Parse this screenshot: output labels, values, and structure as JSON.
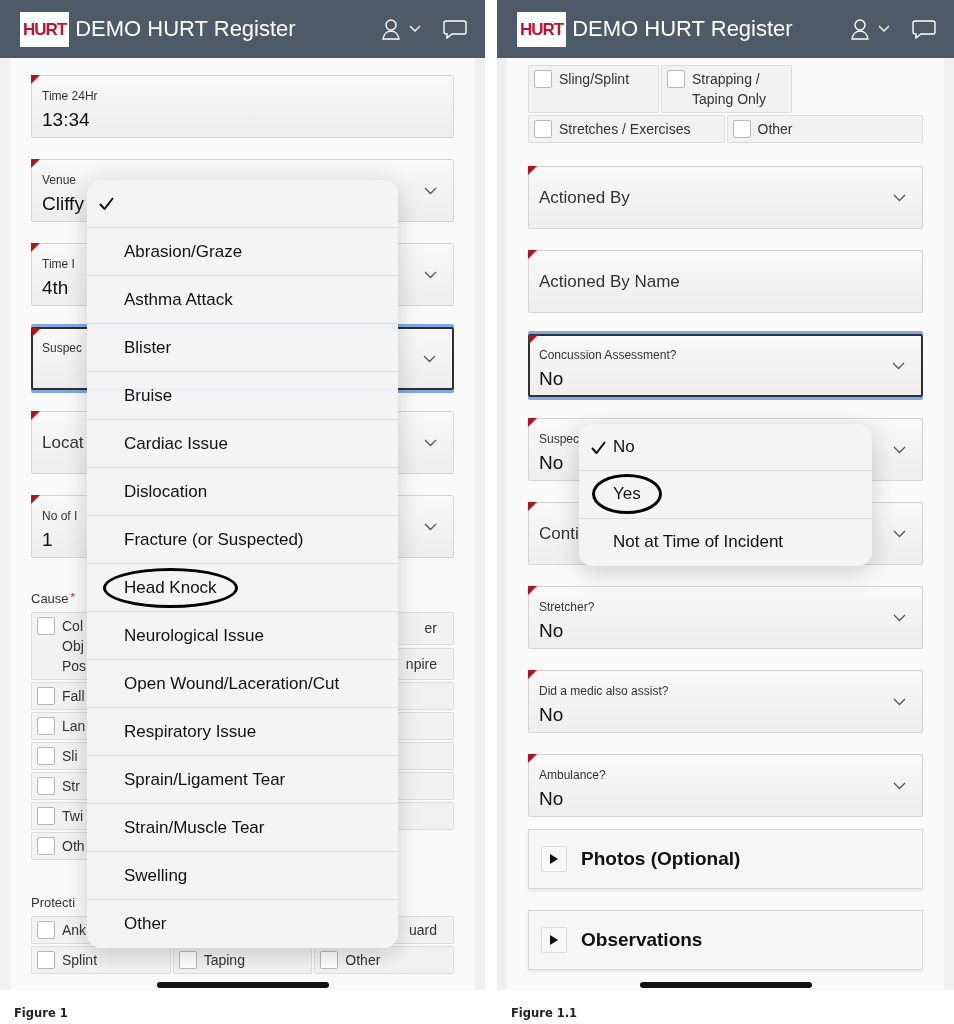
{
  "figures": [
    {
      "header": {
        "logo": "HURT",
        "title": "DEMO HURT Register"
      },
      "items": [
        {
          "kind": "field",
          "label": "Time 24Hr",
          "value": "13:34",
          "dropdown": false,
          "focused": false,
          "required": true
        },
        {
          "kind": "field",
          "label": "Venue",
          "value": "Cliffy",
          "dropdown": true,
          "focused": false,
          "required": true
        },
        {
          "kind": "field",
          "label": "Time I",
          "value": "4th",
          "dropdown": true,
          "focused": false,
          "required": true
        },
        {
          "kind": "field",
          "label": "Suspec",
          "dropdown": true,
          "focused": true,
          "required": true
        },
        {
          "kind": "field",
          "label": "Locat",
          "dropdown": true,
          "focused": false,
          "required": true
        },
        {
          "kind": "field",
          "label": "No of I",
          "value": "1",
          "dropdown": true,
          "focused": false,
          "required": true
        },
        {
          "kind": "checks",
          "label": "Cause",
          "required_mark": "*",
          "rows": [
            {
              "cells": [
                {
                  "kind": "check",
                  "lines": [
                    "Col",
                    "Obj",
                    "Pos"
                  ],
                  "checked": false
                },
                {
                  "kind": "spacer"
                },
                {
                  "kind": "stack",
                  "cells": [
                    {
                      "kind": "tail",
                      "label": "er"
                    },
                    {
                      "kind": "tail",
                      "label": "npire"
                    }
                  ]
                }
              ]
            },
            {
              "cells": [
                {
                  "kind": "check",
                  "label": "Fall",
                  "checked": false
                },
                {
                  "kind": "spacer"
                },
                {
                  "kind": "blank"
                }
              ]
            },
            {
              "cells": [
                {
                  "kind": "check",
                  "label": "Lan",
                  "checked": false
                },
                {
                  "kind": "spacer"
                },
                {
                  "kind": "blank"
                }
              ]
            },
            {
              "cells": [
                {
                  "kind": "check",
                  "label": "Sli",
                  "checked": false
                },
                {
                  "kind": "spacer"
                },
                {
                  "kind": "blank"
                }
              ]
            },
            {
              "cells": [
                {
                  "kind": "check",
                  "label": "Str",
                  "checked": false
                },
                {
                  "kind": "blank"
                },
                {
                  "kind": "blank"
                }
              ]
            },
            {
              "cells": [
                {
                  "kind": "check",
                  "label": "Twi",
                  "checked": false
                },
                {
                  "kind": "blank"
                },
                {
                  "kind": "blank"
                }
              ]
            },
            {
              "cells": [
                {
                  "kind": "check",
                  "label": "Oth",
                  "checked": false
                },
                {
                  "kind": "spacer"
                },
                {
                  "kind": "spacer"
                }
              ]
            }
          ]
        },
        {
          "kind": "checks",
          "label": "Protecti",
          "rows": [
            {
              "cells": [
                {
                  "kind": "check",
                  "label": "Ank",
                  "checked": false
                },
                {
                  "kind": "blank"
                },
                {
                  "kind": "tail",
                  "label": "uard"
                }
              ]
            },
            {
              "cells": [
                {
                  "kind": "check",
                  "label": "Splint",
                  "checked": false
                },
                {
                  "kind": "check",
                  "label": "Taping",
                  "checked": false
                },
                {
                  "kind": "check",
                  "label": "Other",
                  "checked": false
                }
              ]
            }
          ]
        }
      ],
      "menu": {
        "options": [
          {
            "selected": true,
            "circled": false
          },
          {
            "label": "Abrasion/Graze",
            "selected": false,
            "circled": false
          },
          {
            "label": "Asthma Attack",
            "selected": false,
            "circled": false
          },
          {
            "label": "Blister",
            "selected": false,
            "circled": false
          },
          {
            "label": "Bruise",
            "selected": false,
            "circled": false
          },
          {
            "label": "Cardiac Issue",
            "selected": false,
            "circled": false
          },
          {
            "label": "Dislocation",
            "selected": false,
            "circled": false
          },
          {
            "label": "Fracture (or Suspected)",
            "selected": false,
            "circled": false
          },
          {
            "label": "Head Knock",
            "selected": false,
            "circled": true
          },
          {
            "label": "Neurological Issue",
            "selected": false,
            "circled": false
          },
          {
            "label": "Open Wound/Laceration/Cut",
            "selected": false,
            "circled": false
          },
          {
            "label": "Respiratory Issue",
            "selected": false,
            "circled": false
          },
          {
            "label": "Sprain/Ligament Tear",
            "selected": false,
            "circled": false
          },
          {
            "label": "Strain/Muscle Tear",
            "selected": false,
            "circled": false
          },
          {
            "label": "Swelling",
            "selected": false,
            "circled": false
          },
          {
            "label": "Other",
            "selected": false,
            "circled": false
          }
        ]
      },
      "caption": "Figure 1"
    },
    {
      "header": {
        "logo": "HURT",
        "title": "DEMO HURT Register"
      },
      "items": [
        {
          "kind": "checks",
          "rows": [
            {
              "cells": [
                {
                  "kind": "check",
                  "label": "Sling/Splint",
                  "checked": false
                },
                {
                  "kind": "check",
                  "lines": [
                    "Strapping /",
                    "Taping Only"
                  ],
                  "checked": false
                },
                {
                  "kind": "spacer"
                }
              ]
            },
            {
              "cells": [
                {
                  "kind": "check",
                  "label": "Stretches / Exercises",
                  "checked": false
                },
                {
                  "kind": "check",
                  "label": "Other",
                  "checked": false
                }
              ]
            }
          ]
        },
        {
          "kind": "field",
          "label": "Actioned By",
          "dropdown": true,
          "focused": false,
          "required": true
        },
        {
          "kind": "field",
          "label": "Actioned By Name",
          "dropdown": false,
          "focused": false,
          "required": true
        },
        {
          "kind": "field",
          "label": "Concussion Assessment?",
          "value": "No",
          "dropdown": true,
          "focused": true,
          "required": true
        },
        {
          "kind": "field",
          "label": "Suspec",
          "value": "No",
          "dropdown": true,
          "focused": false,
          "required": true
        },
        {
          "kind": "field",
          "label": "Conti",
          "dropdown": true,
          "focused": false,
          "required": true
        },
        {
          "kind": "field",
          "label": "Stretcher?",
          "value": "No",
          "dropdown": true,
          "focused": false,
          "required": true
        },
        {
          "kind": "field",
          "label": "Did a medic also assist?",
          "value": "No",
          "dropdown": true,
          "focused": false,
          "required": true
        },
        {
          "kind": "field",
          "label": "Ambulance?",
          "value": "No",
          "dropdown": true,
          "focused": false,
          "required": true
        },
        {
          "kind": "collapsible",
          "title": "Photos (Optional)",
          "expanded": false
        },
        {
          "kind": "collapsible",
          "title": "Observations",
          "expanded": false
        }
      ],
      "menu": {
        "options": [
          {
            "label": "No",
            "selected": true,
            "circled": false
          },
          {
            "label": "Yes",
            "selected": false,
            "circled": true
          },
          {
            "label": "Not at Time of Incident",
            "selected": false,
            "circled": false
          }
        ]
      },
      "caption": "Figure 1.1"
    }
  ]
}
